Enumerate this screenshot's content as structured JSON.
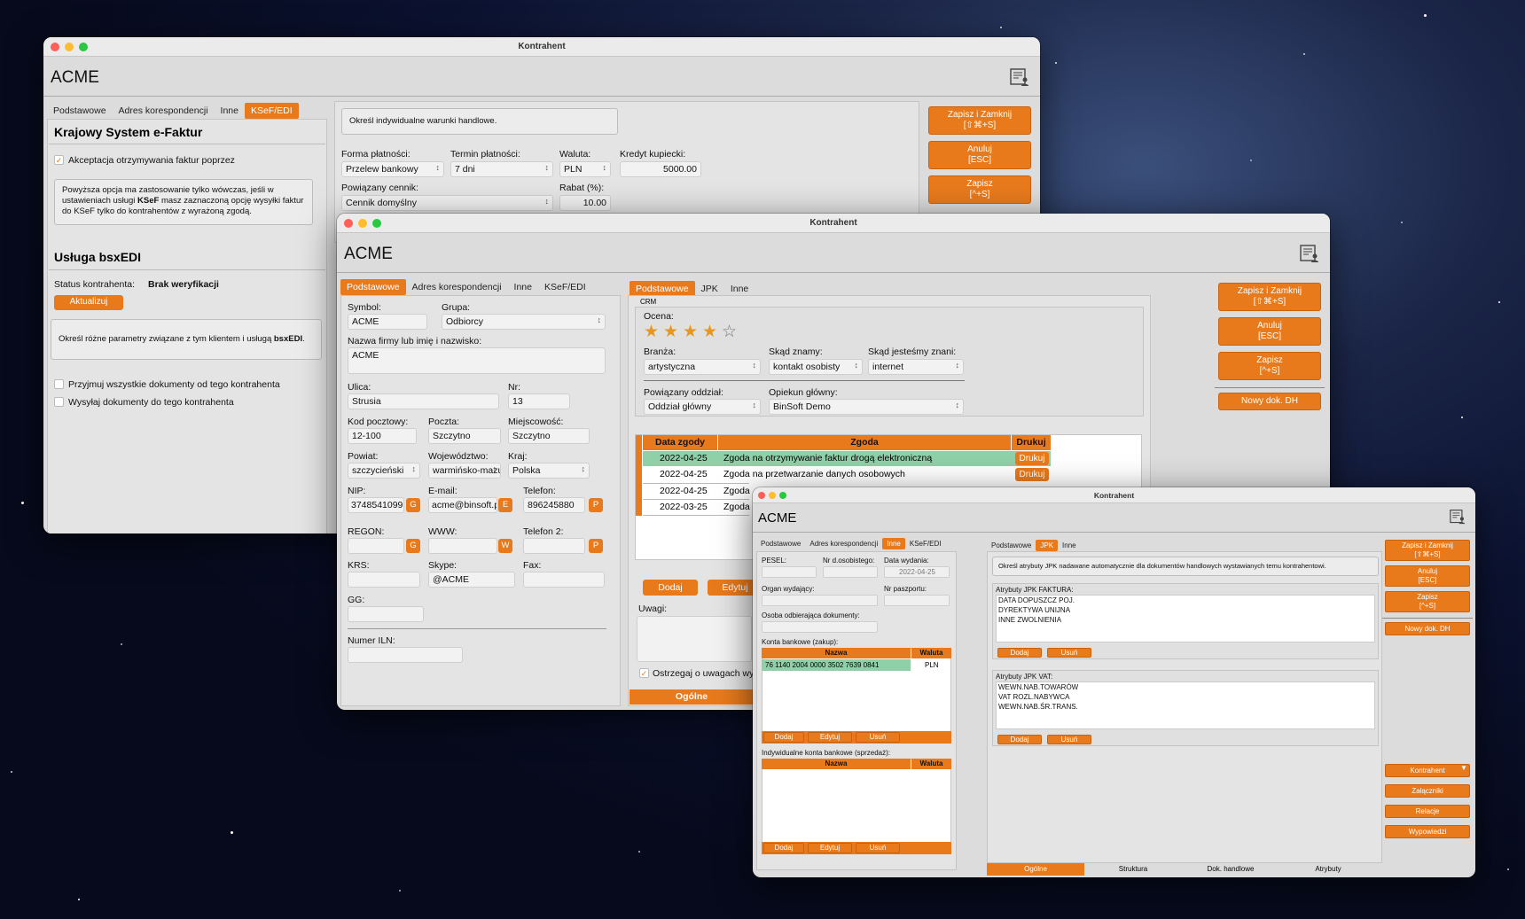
{
  "win1": {
    "title": "Kontrahent",
    "name": "ACME",
    "tabs": [
      "Podstawowe",
      "Adres korespondencji",
      "Inne",
      "KSeF/EDI"
    ],
    "ksef_heading": "Krajowy System e-Faktur",
    "ksef_check": "Akceptacja otrzymywania faktur poprzez",
    "ksef_note_1": "Powyższa opcja ma zastosowanie tylko wówczas, jeśli w ustawieniach usługi ",
    "ksef_note_b": "KSeF",
    "ksef_note_2": " masz zaznaczoną opcję wysyłki faktur do KSeF tylko do kontrahentów z wyrażoną zgodą.",
    "edi_heading": "Usługa bsxEDI",
    "status_label": "Status kontrahenta:",
    "status_value": "Brak weryfikacji",
    "update_btn": "Aktualizuj",
    "edi_note_1": "Określ różne parametry związane z tym klientem i usługą ",
    "edi_note_b": "bsxEDI",
    "edi_note_2": ".",
    "check_accept": "Przyjmuj wszystkie dokumenty od tego kontrahenta",
    "check_send": "Wysyłaj dokumenty do tego kontrahenta",
    "trade_note": "Określ indywidualne warunki handlowe.",
    "pay_form_label": "Forma płatności:",
    "pay_form": "Przelew bankowy",
    "pay_term_label": "Termin płatności:",
    "pay_term": "7 dni",
    "currency_label": "Waluta:",
    "currency": "PLN",
    "credit_label": "Kredyt kupiecki:",
    "credit": "5000.00",
    "pricelist_label": "Powiązany cennik:",
    "pricelist": "Cennik domyślny",
    "discount_label": "Rabat (%):",
    "discount": "10.00",
    "btn_save_close": "Zapisz i Zamknij",
    "btn_save_close_k": "[⇧⌘+S]",
    "btn_cancel": "Anuluj",
    "btn_cancel_k": "[ESC]",
    "btn_save": "Zapisz",
    "btn_save_k": "[^+S]"
  },
  "win2": {
    "title": "Kontrahent",
    "name": "ACME",
    "tabs": [
      "Podstawowe",
      "Adres korespondencji",
      "Inne",
      "KSeF/EDI"
    ],
    "rtabs": [
      "Podstawowe",
      "JPK",
      "Inne"
    ],
    "symbol_label": "Symbol:",
    "symbol": "ACME",
    "group_label": "Grupa:",
    "group": "Odbiorcy",
    "company_label": "Nazwa firmy lub imię i nazwisko:",
    "company": "ACME",
    "street_label": "Ulica:",
    "street": "Strusia",
    "nr_label": "Nr:",
    "nr": "13",
    "zip_label": "Kod pocztowy:",
    "zip": "12-100",
    "post_label": "Poczta:",
    "post": "Szczytno",
    "city_label": "Miejscowość:",
    "city": "Szczytno",
    "county_label": "Powiat:",
    "county": "szczycieński",
    "voiv_label": "Województwo:",
    "voiv": "warmińsko-mazu",
    "country_label": "Kraj:",
    "country": "Polska",
    "nip_label": "NIP:",
    "nip": "3748541099",
    "email_label": "E-mail:",
    "email": "acme@binsoft.p",
    "phone_label": "Telefon:",
    "phone": "896245880",
    "regon_label": "REGON:",
    "www_label": "WWW:",
    "phone2_label": "Telefon 2:",
    "krs_label": "KRS:",
    "skype_label": "Skype:",
    "skype": "@ACME",
    "fax_label": "Fax:",
    "gg_label": "GG:",
    "iln_label": "Numer ILN:",
    "btn_g": "G",
    "btn_e": "E",
    "btn_p": "P",
    "btn_w": "W",
    "crm_label": "CRM",
    "rating_label": "Ocena:",
    "rating": 4,
    "rating_max": 5,
    "branch_label": "Branża:",
    "branch": "artystyczna",
    "known_label": "Skąd znamy:",
    "known": "kontakt osobisty",
    "knownby_label": "Skąd jesteśmy znani:",
    "knownby": "internet",
    "dept_label": "Powiązany oddział:",
    "dept": "Oddział główny",
    "keeper_label": "Opiekun główny:",
    "keeper": "BinSoft Demo",
    "consent_headers": [
      "Data zgody",
      "Zgoda",
      "Drukuj"
    ],
    "consents": [
      {
        "date": "2022-04-25",
        "text": "Zgoda na otrzymywanie faktur drogą elektroniczną",
        "print": "Drukuj"
      },
      {
        "date": "2022-04-25",
        "text": "Zgoda na przetwarzanie danych osobowych",
        "print": "Drukuj"
      },
      {
        "date": "2022-04-25",
        "text": "Zgoda",
        "print": ""
      },
      {
        "date": "2022-03-25",
        "text": "Zgoda",
        "print": ""
      }
    ],
    "btn_add": "Dodaj",
    "btn_edit": "Edytuj",
    "notes_label": "Uwagi:",
    "warn_label": "Ostrzegaj o uwagach wy",
    "bottom_tab": "Ogólne",
    "btn_save_close": "Zapisz i Zamknij",
    "btn_save_close_k": "[⇧⌘+S]",
    "btn_cancel": "Anuluj",
    "btn_cancel_k": "[ESC]",
    "btn_save": "Zapisz",
    "btn_save_k": "[^+S]",
    "btn_new_doc": "Nowy dok. DH"
  },
  "win3": {
    "title": "Kontrahent",
    "name": "ACME",
    "tabs": [
      "Podstawowe",
      "Adres korespondencji",
      "Inne",
      "KSeF/EDI"
    ],
    "rtabs": [
      "Podstawowe",
      "JPK",
      "Inne"
    ],
    "pesel_label": "PESEL:",
    "idno_label": "Nr d.osobistego:",
    "issue_label": "Data wydania:",
    "issue": "2022-04-25",
    "org_label": "Organ wydający:",
    "passport_label": "Nr paszportu:",
    "pickup_label": "Osoba odbierająca dokumenty:",
    "bank_buy_label": "Konta bankowe (zakup):",
    "bank_headers": [
      "Nazwa",
      "Waluta"
    ],
    "bank_rows": [
      {
        "name": "76 1140 2004 0000 3502 7639 0841",
        "cur": "PLN"
      }
    ],
    "btn_add": "Dodaj",
    "btn_edit": "Edytuj",
    "btn_del": "Usuń",
    "bank_sell_label": "Indywidualne konta bankowe (sprzedaż):",
    "jpk_note": "Określ atrybuty JPK nadawane automatycznie dla dokumentów handlowych wystawianych temu kontrahentowi.",
    "jpk_fa_label": "Atrybuty JPK FAKTURA:",
    "jpk_fa": [
      "DATA DOPUSZCZ POJ.",
      "DYREKTYWA UNIJNA",
      "INNE ZWOLNIENIA"
    ],
    "jpk_vat_label": "Atrybuty JPK VAT:",
    "jpk_vat": [
      "WEWN.NAB.TOWARÓW",
      "VAT ROZL.NABYWCA",
      "WEWN.NAB.ŚR.TRANS."
    ],
    "bottom_tabs": [
      "Ogólne",
      "Struktura",
      "Dok. handlowe",
      "Atrybuty"
    ],
    "btn_save_close": "Zapisz i Zamknij",
    "btn_save_close_k": "[⇧⌘+S]",
    "btn_cancel": "Anuluj",
    "btn_cancel_k": "[ESC]",
    "btn_save": "Zapisz",
    "btn_save_k": "[^+S]",
    "btn_new_doc": "Nowy dok. DH",
    "side_btns": [
      "Kontrahent",
      "Załączniki",
      "Relacje",
      "Wypowiedzi"
    ]
  },
  "colors": {
    "accent": "#e87a1c",
    "selected_row": "#8fd0a8"
  }
}
